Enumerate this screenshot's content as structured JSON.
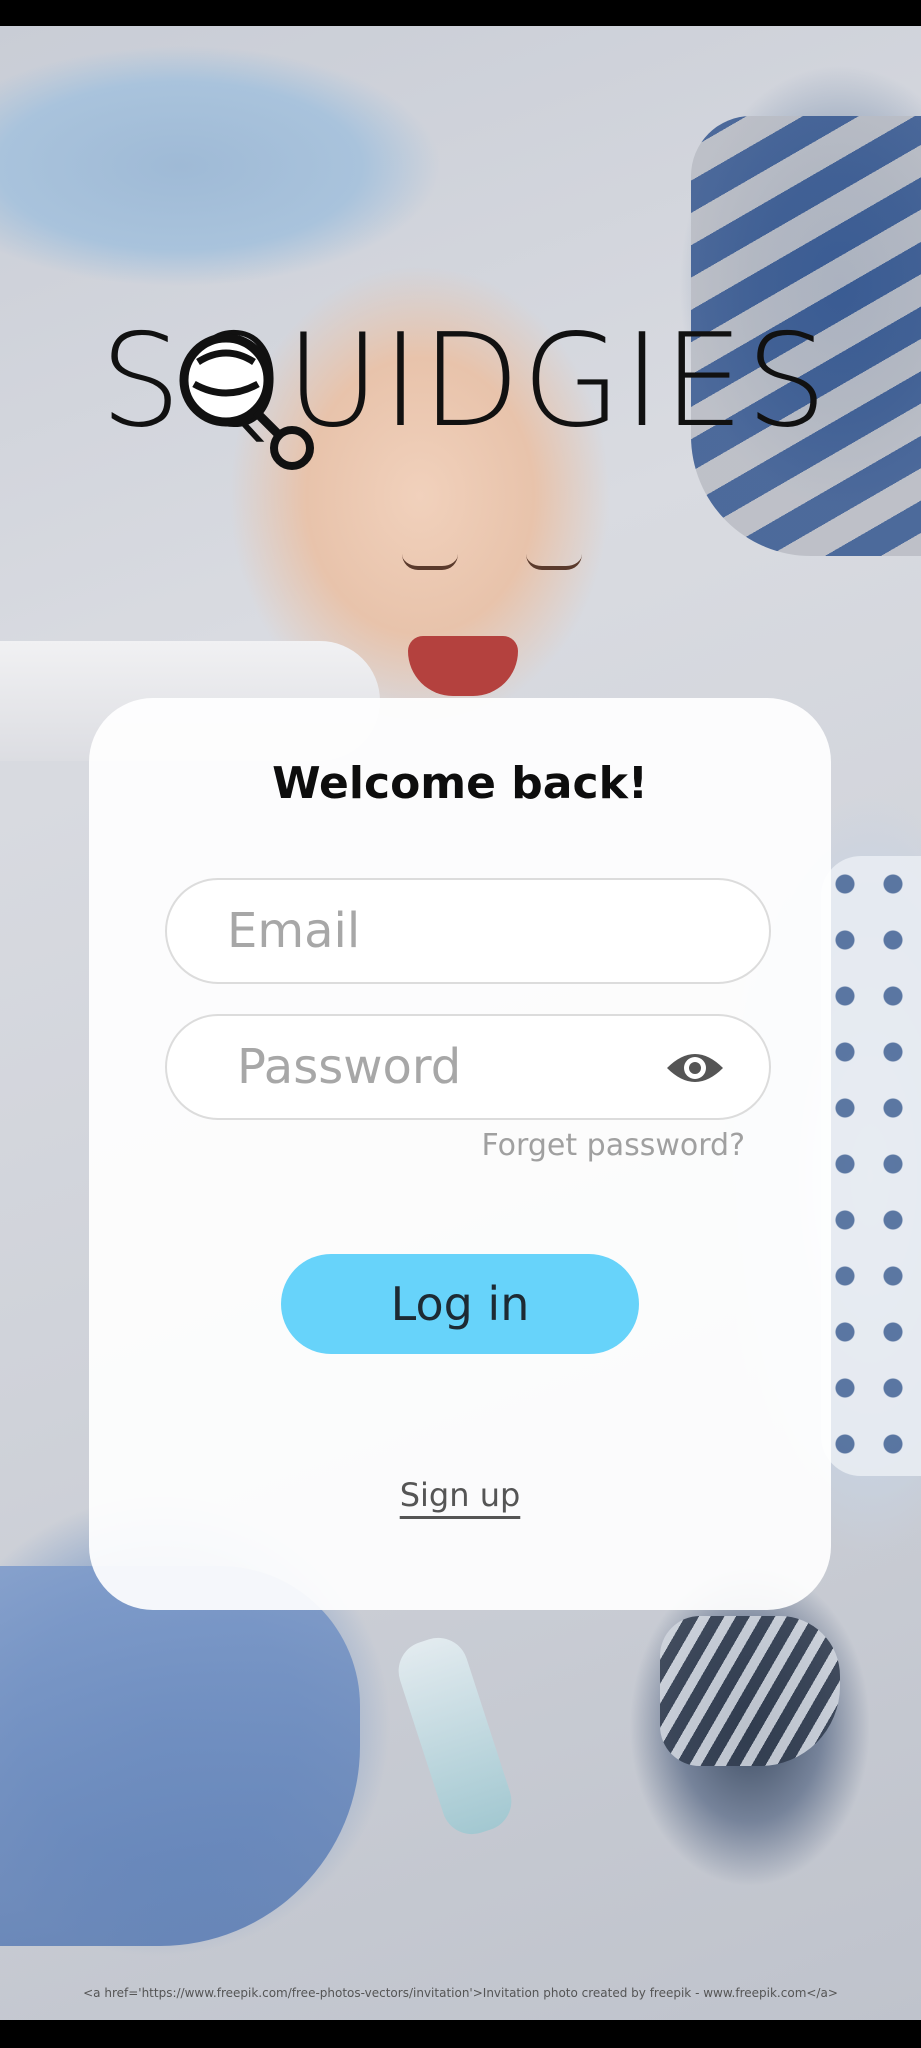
{
  "app": {
    "logo_text": "SQUIDGIES",
    "logo_icon": "rattle-icon"
  },
  "login_card": {
    "title": "Welcome back!",
    "email_placeholder": "Email",
    "password_placeholder": "Password",
    "password_toggle_icon": "eye-icon",
    "forgot_password": "Forget password?",
    "login_button": "Log in",
    "signup_link": "Sign up"
  },
  "footer": {
    "attribution": "<a href='https://www.freepik.com/free-photos-vectors/invitation'>Invitation photo created by freepik - www.freepik.com</a>"
  },
  "colors": {
    "login_button": "#67d3fa",
    "card_background": "#ffffff"
  }
}
